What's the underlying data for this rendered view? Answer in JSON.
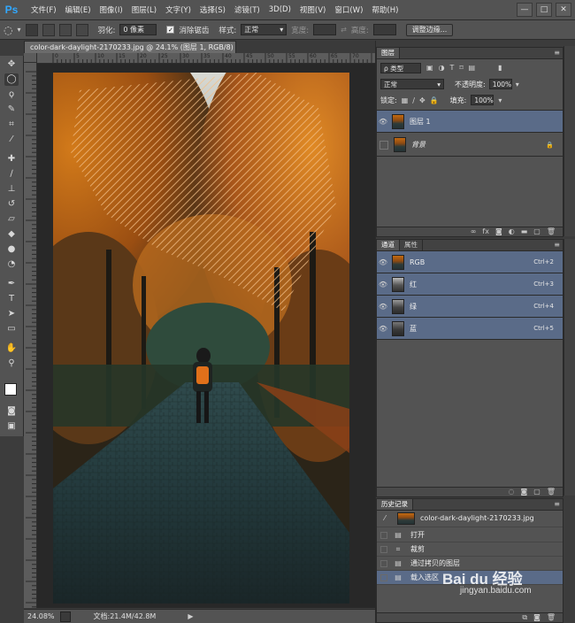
{
  "app": {
    "logo": "Ps",
    "menu": [
      "文件(F)",
      "编辑(E)",
      "图像(I)",
      "图层(L)",
      "文字(Y)",
      "选择(S)",
      "滤镜(T)",
      "3D(D)",
      "视图(V)",
      "窗口(W)",
      "帮助(H)"
    ],
    "window_controls": [
      "—",
      "□",
      "✕"
    ]
  },
  "options": {
    "feather_label": "羽化:",
    "feather_value": "0 像素",
    "antialias_label": "消除锯齿",
    "style_label": "样式:",
    "style_value": "正常",
    "width_label": "宽度:",
    "height_label": "高度:",
    "refine_button": "调整边缘..."
  },
  "document": {
    "tab_title": "color-dark-daylight-2170233.jpg @ 24.1% (图层 1, RGB/8) *",
    "tab_close": "×",
    "ruler_marks": [
      "0",
      "5",
      "10",
      "15",
      "20",
      "25",
      "30",
      "35",
      "40",
      "45",
      "50",
      "55",
      "60",
      "65",
      "70"
    ],
    "status_zoom": "24.08%",
    "status_doc": "文档:21.4M/42.8M"
  },
  "layers_panel": {
    "tab": "图层",
    "filter_label": "ρ 类型",
    "blend_mode": "正常",
    "opacity_label": "不透明度:",
    "opacity_value": "100%",
    "lock_label": "锁定:",
    "fill_label": "填充:",
    "fill_value": "100%",
    "layers": [
      {
        "name": "图层 1",
        "selected": true
      },
      {
        "name": "背景",
        "selected": false
      }
    ]
  },
  "channels_panel": {
    "tabs": [
      "通道",
      "属性"
    ],
    "channels": [
      {
        "name": "RGB",
        "shortcut": "Ctrl+2"
      },
      {
        "name": "红",
        "shortcut": "Ctrl+3"
      },
      {
        "name": "绿",
        "shortcut": "Ctrl+4"
      },
      {
        "name": "蓝",
        "shortcut": "Ctrl+5"
      }
    ]
  },
  "history_panel": {
    "tab": "历史记录",
    "snapshot": "color-dark-daylight-2170233.jpg",
    "items": [
      "打开",
      "裁剪",
      "通过拷贝的图层",
      "载入选区"
    ]
  },
  "watermark": {
    "brand": "Bai du 经验",
    "url": "jingyan.baidu.com"
  },
  "colors": {
    "chrome": "#535353",
    "dark": "#3c3c3c",
    "selected_row": "#5a6b88",
    "accent": "#31a8ff"
  }
}
